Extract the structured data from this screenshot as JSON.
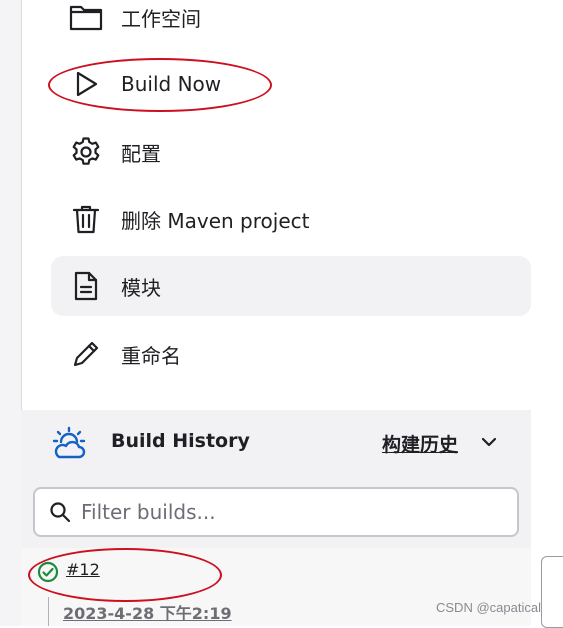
{
  "menu": {
    "items": [
      {
        "label": "工作空间"
      },
      {
        "label": "Build Now"
      },
      {
        "label": "配置"
      },
      {
        "label": "删除 Maven project"
      },
      {
        "label": "模块"
      },
      {
        "label": "重命名"
      }
    ]
  },
  "history": {
    "title": "Build History",
    "link": "构建历史",
    "filter_placeholder": "Filter builds...",
    "builds": [
      {
        "number": "#12",
        "date": "2023-4-28 下午2:19",
        "status": "success"
      }
    ]
  },
  "watermark": "CSDN @capatical",
  "colors": {
    "highlight": "#cc1020",
    "success": "#1e8a3e",
    "weather_icon": "#1462c4"
  }
}
